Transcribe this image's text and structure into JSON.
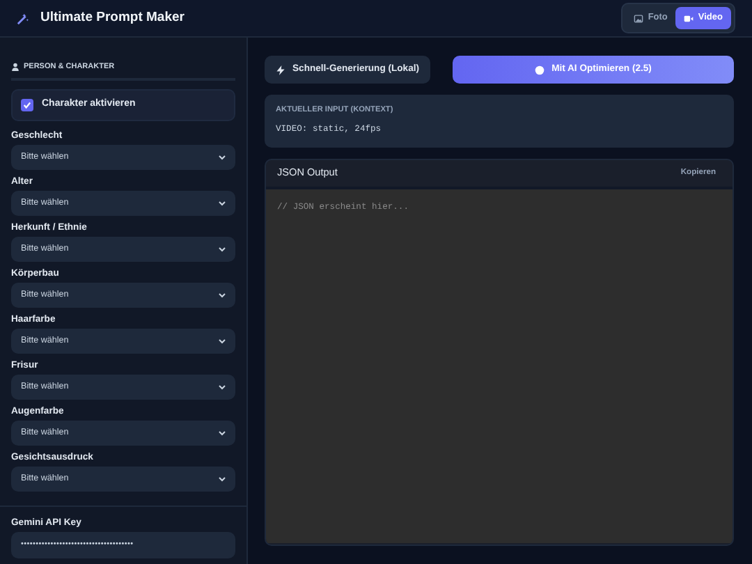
{
  "app": {
    "title": "Ultimate Prompt Maker"
  },
  "mode_tabs": [
    {
      "label": "Foto",
      "selected": false
    },
    {
      "label": "Video",
      "selected": true
    }
  ],
  "sidebar": {
    "section_title": "PERSON & CHARAKTER",
    "toggle": {
      "label": "Charakter aktivieren",
      "checked": true
    },
    "fields": [
      {
        "label": "Geschlecht",
        "value": "Bitte wählen"
      },
      {
        "label": "Alter",
        "value": "Bitte wählen"
      },
      {
        "label": "Herkunft / Ethnie",
        "value": "Bitte wählen"
      },
      {
        "label": "Körperbau",
        "value": "Bitte wählen"
      },
      {
        "label": "Haarfarbe",
        "value": "Bitte wählen"
      },
      {
        "label": "Frisur",
        "value": "Bitte wählen"
      },
      {
        "label": "Augenfarbe",
        "value": "Bitte wählen"
      },
      {
        "label": "Gesichtsausdruck",
        "value": "Bitte wählen"
      }
    ],
    "api_key": {
      "label": "Gemini API Key",
      "value": "••••••••••••••••••••••••••••••••••••••"
    }
  },
  "actions": [
    {
      "label": "Schnell-Generierung (Lokal)",
      "kind": "secondary"
    },
    {
      "label": "Mit AI Optimieren (2.5)",
      "kind": "primary"
    }
  ],
  "context": {
    "title": "AKTUELLER INPUT (KONTEXT)",
    "value": "VIDEO: static, 24fps"
  },
  "output": {
    "title": "JSON Output",
    "copy_button": "Kopieren",
    "placeholder": "// JSON erscheint hier..."
  }
}
